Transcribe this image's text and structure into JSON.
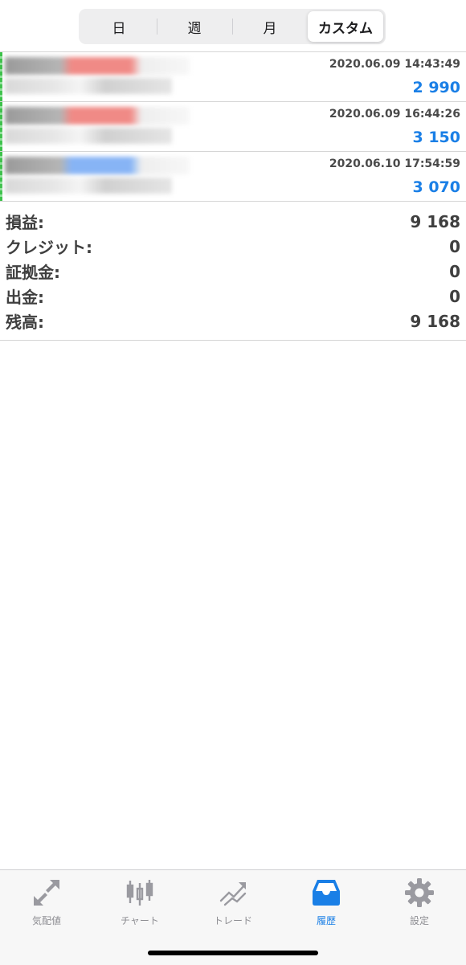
{
  "segmented": {
    "items": [
      {
        "label": "日"
      },
      {
        "label": "週"
      },
      {
        "label": "月"
      },
      {
        "label": "カスタム"
      }
    ],
    "selected": "カスタム"
  },
  "deals": [
    {
      "time": "2020.06.09 14:43:49",
      "amount": "2 990",
      "tint": "#f08a86"
    },
    {
      "time": "2020.06.09 16:44:26",
      "amount": "3 150",
      "tint": "#f08a86"
    },
    {
      "time": "2020.06.10 17:54:59",
      "amount": "3 070",
      "tint": "#87b4f5"
    }
  ],
  "summary": {
    "profit": {
      "label": "損益:",
      "value": "9 168"
    },
    "credit": {
      "label": "クレジット:",
      "value": "0"
    },
    "margin": {
      "label": "証拠金:",
      "value": "0"
    },
    "withdrawal": {
      "label": "出金:",
      "value": "0"
    },
    "balance": {
      "label": "残高:",
      "value": "9 168"
    }
  },
  "tabbar": {
    "items": [
      {
        "label": "気配値",
        "icon": "quotes-arrows-icon"
      },
      {
        "label": "チャート",
        "icon": "candlestick-icon"
      },
      {
        "label": "トレード",
        "icon": "trade-trend-icon"
      },
      {
        "label": "履歴",
        "icon": "history-inbox-icon"
      },
      {
        "label": "設定",
        "icon": "gear-icon"
      }
    ],
    "active": "履歴"
  },
  "colors": {
    "accent": "#1a7fe6",
    "inactive": "#8e8e93",
    "buy_edge": "#3cc24a"
  }
}
